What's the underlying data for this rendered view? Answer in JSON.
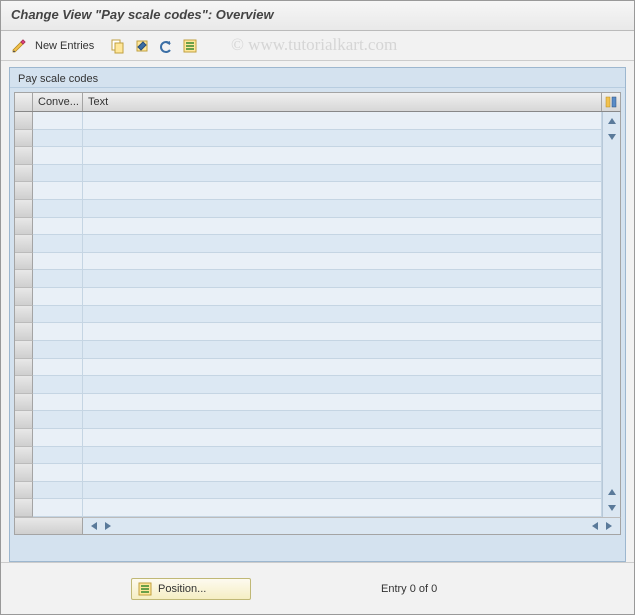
{
  "title": "Change View \"Pay scale codes\": Overview",
  "toolbar": {
    "new_entries": "New Entries"
  },
  "watermark": "© www.tutorialkart.com",
  "group_label": "Pay scale codes",
  "columns": {
    "c1": "Conve...",
    "c2": "Text"
  },
  "rows_count": 23,
  "footer": {
    "position": "Position...",
    "status": "Entry 0 of 0"
  }
}
